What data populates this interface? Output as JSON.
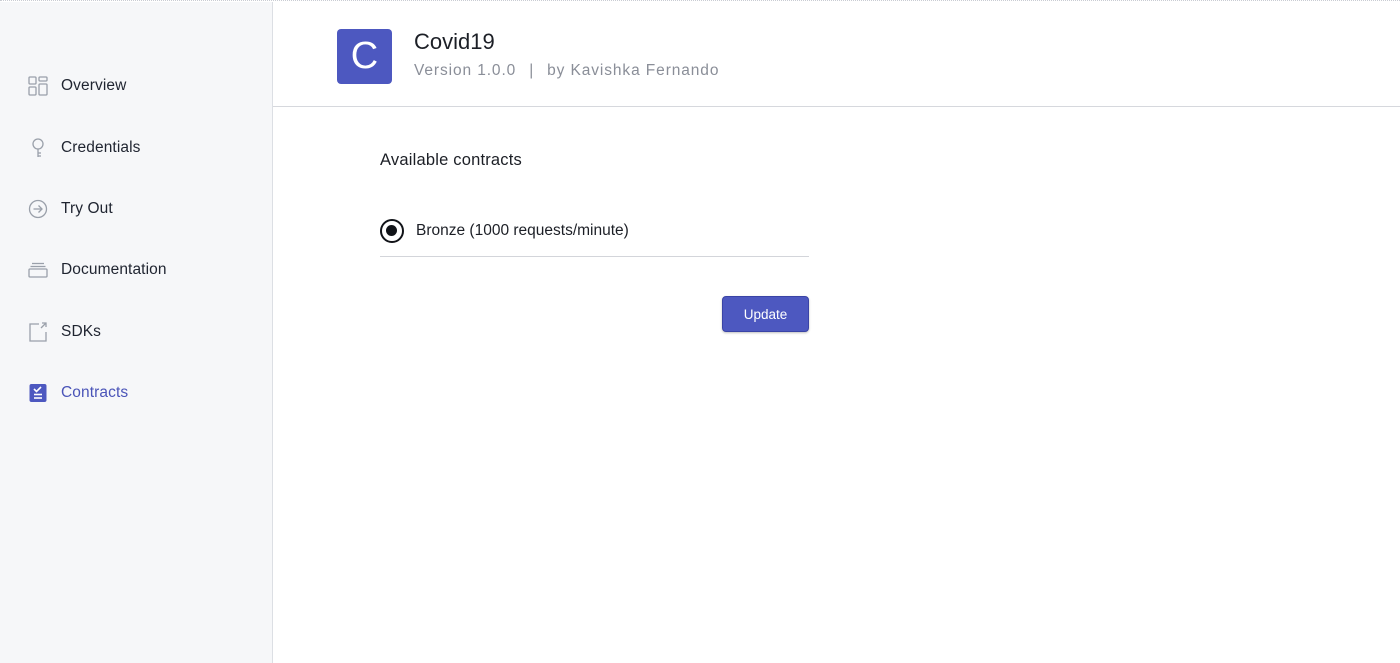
{
  "sidebar": {
    "items": [
      {
        "label": "Overview",
        "icon": "grid-icon",
        "active": false
      },
      {
        "label": "Credentials",
        "icon": "key-icon",
        "active": false
      },
      {
        "label": "Try Out",
        "icon": "arrow-circle-icon",
        "active": false
      },
      {
        "label": "Documentation",
        "icon": "docs-stack-icon",
        "active": false
      },
      {
        "label": "SDKs",
        "icon": "share-box-icon",
        "active": false
      },
      {
        "label": "Contracts",
        "icon": "contract-clipboard-icon",
        "active": true
      }
    ]
  },
  "header": {
    "avatar_letter": "C",
    "title": "Covid19",
    "version": "Version 1.0.0",
    "separator": "|",
    "author": "by Kavishka Fernando"
  },
  "main": {
    "section_title": "Available contracts",
    "contracts": [
      {
        "label": "Bronze (1000 requests/minute)",
        "selected": true
      }
    ],
    "update_label": "Update"
  },
  "colors": {
    "accent": "#4d58c0",
    "active_text": "#4a54b8",
    "sidebar_bg": "#f6f7f9",
    "muted_text": "#8a8e98"
  }
}
